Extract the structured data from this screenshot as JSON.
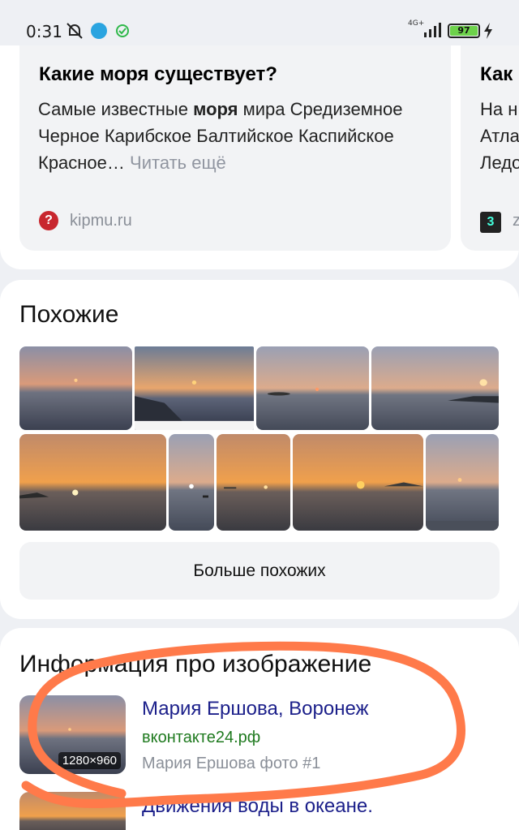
{
  "status_bar": {
    "time": "0:31",
    "network": "4G+",
    "battery": "97",
    "icons": [
      "mute-icon",
      "telegram-icon",
      "check-icon",
      "signal-icon",
      "battery-icon",
      "charging-icon"
    ]
  },
  "answers": [
    {
      "question": "Какие моря существует?",
      "text_before": "Самые известные ",
      "text_bold": "моря",
      "text_after": " мира Средиземное Черное Карибское Балтийское Каспийское Красное… ",
      "more": "Читать ещё",
      "source": "kipmu.ru",
      "source_icon": "question-mark-icon"
    },
    {
      "question": "Как",
      "lines": [
        "На н",
        "Атла",
        "Ледо"
      ],
      "source": "z",
      "source_icon": "z-badge-icon"
    }
  ],
  "similar": {
    "title": "Похожие",
    "more_button": "Больше похожих",
    "thumbnails": 10
  },
  "info": {
    "title": "Информация про изображение",
    "results": [
      {
        "title": "Мария Ершова, Воронеж",
        "domain": "вконтакте24.рф",
        "description": "Мария Ершова фото #1",
        "resolution": "1280×960"
      },
      {
        "title": "Движения воды в океане."
      }
    ]
  },
  "colors": {
    "link": "#1b1f8a",
    "domain": "#1f7a1f",
    "annotation": "#ff7a4a",
    "battery": "#6dd24b"
  }
}
